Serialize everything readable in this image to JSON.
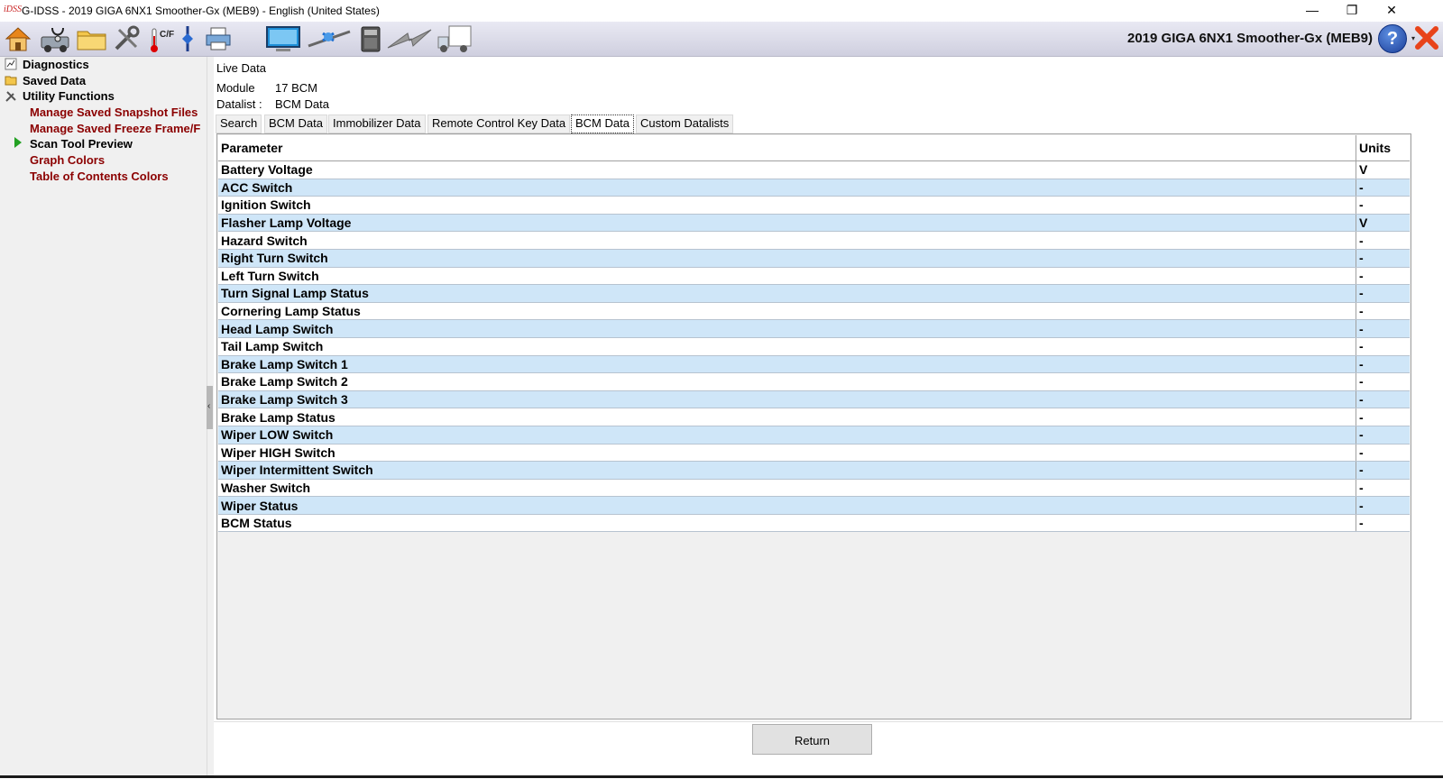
{
  "window": {
    "title": "G-IDSS - 2019 GIGA 6NX1 Smoother-Gx (MEB9) - English (United States)",
    "app_icon_text": "iDSS",
    "minimize": "—",
    "restore": "❐",
    "close": "✕"
  },
  "toolbar": {
    "vehicle_title": "2019 GIGA 6NX1 Smoother-Gx (MEB9)",
    "help_label": "?",
    "help_dropdown": "▾",
    "temp_label": "C/F"
  },
  "tree": {
    "diagnostics": "Diagnostics",
    "saved_data": "Saved Data",
    "utility_functions": "Utility Functions",
    "manage_snapshot": "Manage Saved Snapshot Files",
    "manage_freeze": "Manage Saved Freeze Frame/F",
    "scan_tool_preview": "Scan Tool Preview",
    "graph_colors": "Graph Colors",
    "toc_colors": "Table of Contents Colors"
  },
  "main": {
    "heading": "Live Data",
    "module_label": "Module",
    "module_value": "17 BCM",
    "datalist_label": "Datalist :",
    "datalist_value": "BCM Data",
    "tabs": [
      "Search",
      "BCM Data",
      "Immobilizer Data",
      "Remote Control Key Data",
      "BCM Data",
      "Custom Datalists"
    ],
    "active_tab_index": 4,
    "columns": {
      "parameter": "Parameter",
      "units": "Units"
    },
    "rows": [
      {
        "param": "Battery Voltage",
        "unit": "V"
      },
      {
        "param": "ACC Switch",
        "unit": "-"
      },
      {
        "param": "Ignition Switch",
        "unit": "-"
      },
      {
        "param": "Flasher Lamp Voltage",
        "unit": "V"
      },
      {
        "param": "Hazard Switch",
        "unit": "-"
      },
      {
        "param": "Right Turn Switch",
        "unit": "-"
      },
      {
        "param": "Left Turn Switch",
        "unit": "-"
      },
      {
        "param": "Turn Signal Lamp Status",
        "unit": "-"
      },
      {
        "param": "Cornering Lamp Status",
        "unit": "-"
      },
      {
        "param": "Head Lamp Switch",
        "unit": "-"
      },
      {
        "param": "Tail Lamp Switch",
        "unit": "-"
      },
      {
        "param": "Brake Lamp Switch 1",
        "unit": "-"
      },
      {
        "param": "Brake Lamp Switch 2",
        "unit": "-"
      },
      {
        "param": "Brake Lamp Switch 3",
        "unit": "-"
      },
      {
        "param": "Brake Lamp Status",
        "unit": "-"
      },
      {
        "param": "Wiper LOW Switch",
        "unit": "-"
      },
      {
        "param": "Wiper HIGH Switch",
        "unit": "-"
      },
      {
        "param": "Wiper Intermittent Switch",
        "unit": "-"
      },
      {
        "param": "Washer Switch",
        "unit": "-"
      },
      {
        "param": "Wiper Status",
        "unit": "-"
      },
      {
        "param": "BCM Status",
        "unit": "-"
      }
    ],
    "return_label": "Return"
  },
  "colors": {
    "row_alt": "#cfe6f8",
    "tree_link": "#8b0000",
    "toolbar_bg": "#dcdce8"
  },
  "icons": [
    "home-icon",
    "diagnostic-vehicle-icon",
    "folder-icon",
    "tools-icon",
    "thermometer-icon",
    "flash-icon",
    "printer-icon",
    "monitor-icon",
    "network-icon",
    "device-icon",
    "flash-programming-icon",
    "truck-icon"
  ]
}
